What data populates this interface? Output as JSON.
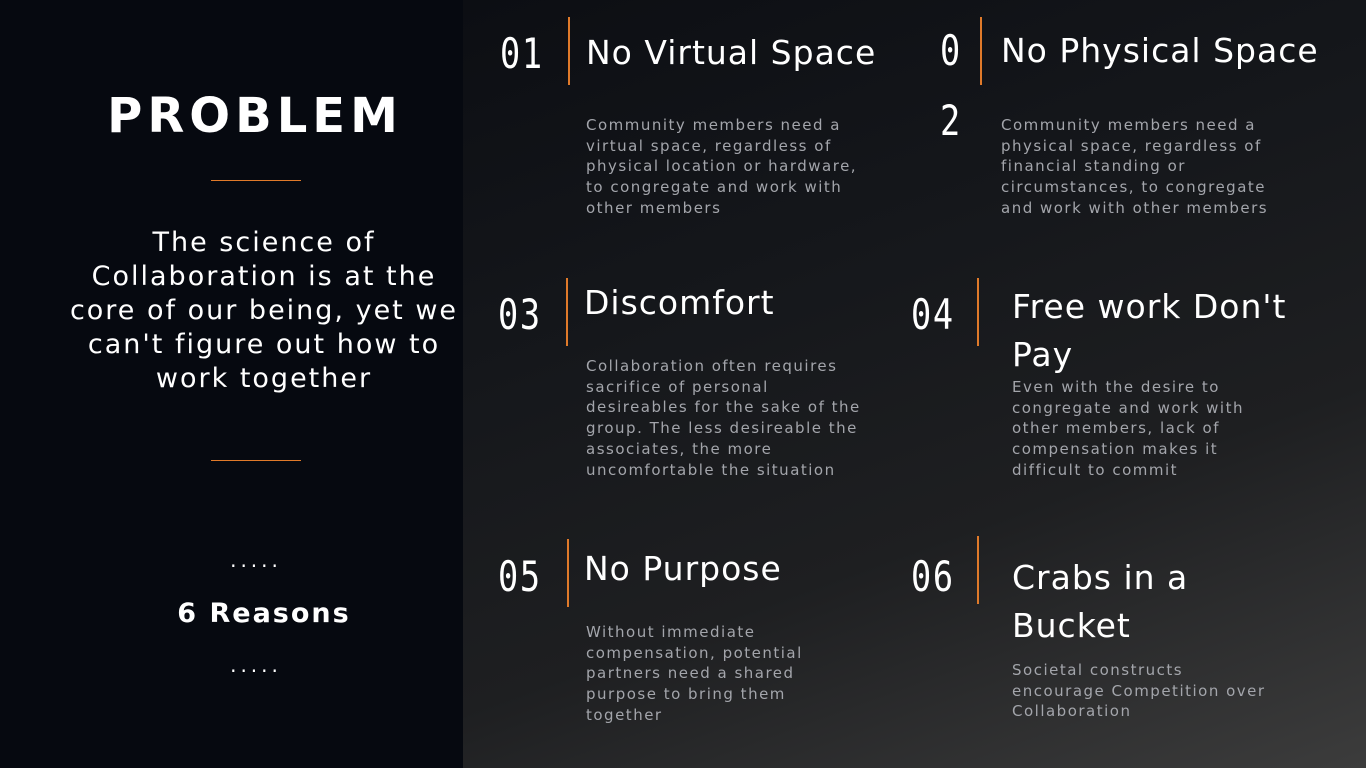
{
  "left": {
    "title": "PROBLEM",
    "tagline": "The science of Collaboration is at the core of our being, yet we can't figure out how to work together",
    "dots_top": ".....",
    "reasons": "6 Reasons",
    "dots_bottom": "....."
  },
  "items": [
    {
      "number": "01",
      "title": "No Virtual Space",
      "description": "Community members need a virtual space, regardless of physical location or hardware, to congregate and work with other members"
    },
    {
      "number_line1": "0",
      "number_line2": "2",
      "title": "No Physical Space",
      "description": "Community members need a physical space, regardless of financial standing or circumstances, to congregate and work with other members"
    },
    {
      "number": "03",
      "title": "Discomfort",
      "description": "Collaboration often requires sacrifice of personal desireables for the sake of the group. The less desireable the associates, the more uncomfortable the situation"
    },
    {
      "number": "04",
      "title": "Free work Don't Pay",
      "description": "Even with the desire to congregate and work with other members, lack of compensation makes it difficult to commit"
    },
    {
      "number": "05",
      "title": "No Purpose",
      "description": "Without immediate compensation, potential partners need a shared purpose to bring them together"
    },
    {
      "number": "06",
      "title": "Crabs in a Bucket",
      "description": "Societal constructs encourage Competition over Collaboration"
    }
  ],
  "colors": {
    "accent": "#e07a2a",
    "left_bg": "#060910",
    "description_text": "#a3a5ab"
  }
}
